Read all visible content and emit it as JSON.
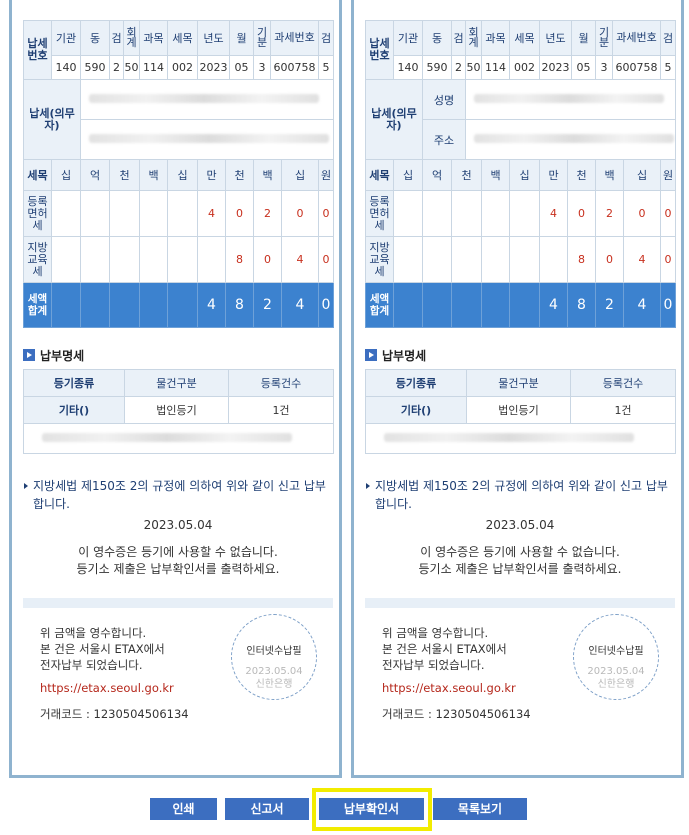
{
  "tax_table": {
    "row_label": "납세번호",
    "headers": [
      "기관",
      "동",
      "검",
      "회계",
      "과목",
      "세목",
      "년도",
      "월",
      "기분",
      "과세번호",
      "검"
    ],
    "values": [
      "140",
      "590",
      "2",
      "50",
      "114",
      "002",
      "2023",
      "05",
      "3",
      "600758",
      "5"
    ],
    "taxpayer_label": "납세(의무자)",
    "name_label": "성명",
    "address_label": "주소",
    "units_label": "세목",
    "units": [
      "십",
      "억",
      "천",
      "백",
      "십",
      "만",
      "천",
      "백",
      "십",
      "원"
    ],
    "rows": [
      {
        "label": "등록면허세",
        "digits": [
          "",
          "",
          "",
          "",
          "",
          "4",
          "0",
          "2",
          "0",
          "0"
        ]
      },
      {
        "label": "지방교육세",
        "digits": [
          "",
          "",
          "",
          "",
          "",
          "",
          "8",
          "0",
          "4",
          "0"
        ]
      }
    ],
    "total": {
      "label": "세액합계",
      "digits": [
        "",
        "",
        "",
        "",
        "",
        "4",
        "8",
        "2",
        "4",
        "0"
      ]
    }
  },
  "detail": {
    "title": "납부명세",
    "headers": [
      "등기종류",
      "물건구분",
      "등록건수"
    ],
    "row": [
      "기타()",
      "법인등기",
      "1건"
    ]
  },
  "note": "지방세법 제150조 2의 규정에 의하여 위와 같이 신고 납부합니다.",
  "date": "2023.05.04",
  "warning_line1": "이 영수증은 등기에 사용할 수 없습니다.",
  "warning_line2": "등기소 제출은 납부확인서를 출력하세요.",
  "receipt": {
    "line1": "위 금액을 영수합니다.",
    "line2": "본 건은 서울시 ETAX에서",
    "line3": "전자납부 되었습니다.",
    "url": "https://etax.seoul.go.kr",
    "code": "거래코드 : 1230504506134"
  },
  "stamp": {
    "title": "인터넷수납필",
    "date": "2023.05.04",
    "bank": "신한은행"
  },
  "buttons": {
    "print": "인쇄",
    "report": "신고서",
    "confirm": "납부확인서",
    "list": "목록보기"
  },
  "colors": {
    "accent": "#3c82cf",
    "button": "#3c6ec0",
    "highlight": "#f2ec00",
    "amount": "#c8301e"
  }
}
